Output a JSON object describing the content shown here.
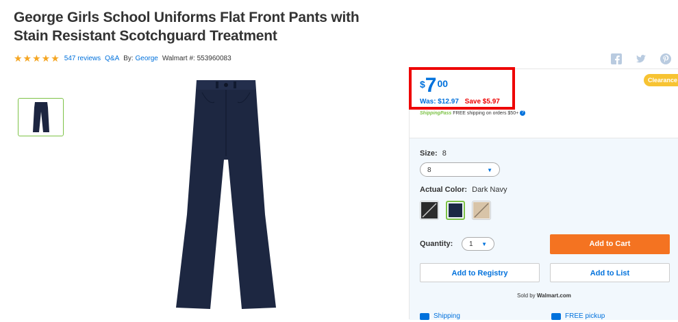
{
  "product": {
    "title": "George Girls School Uniforms Flat Front Pants with Stain Resistant Scotchguard Treatment",
    "rating_stars": "★★★★★",
    "reviews": "547 reviews",
    "qa": "Q&A",
    "by_label": "By:",
    "brand": "George",
    "walmart_number": "Walmart #: 553960083"
  },
  "price": {
    "currency": "$",
    "dollars": "7",
    "cents": "00",
    "was": "Was: $12.97",
    "save": "Save $5.97",
    "badge": "Clearance",
    "shipping_pass": "ShippingPass",
    "shipping_text": "FREE shipping on orders $50+",
    "help_icon": "?"
  },
  "options": {
    "size_label": "Size:",
    "size_value": "8",
    "size_selected": "8",
    "color_label": "Actual Color:",
    "color_value": "Dark Navy",
    "swatches": [
      {
        "name": "black",
        "color": "#2b2b2b"
      },
      {
        "name": "dark-navy",
        "color": "#1b2a44"
      },
      {
        "name": "khaki",
        "color": "#d8c4a8"
      }
    ],
    "quantity_label": "Quantity:",
    "quantity_value": "1"
  },
  "actions": {
    "add_to_cart": "Add to Cart",
    "add_to_registry": "Add to Registry",
    "add_to_list": "Add to List",
    "sold_by_prefix": "Sold by",
    "sold_by": "Walmart.com",
    "shipping": "Shipping",
    "free_pickup": "FREE pickup"
  },
  "colors": {
    "brand_blue": "#0071dc",
    "cart_orange": "#f47321",
    "highlight_red": "#e00000",
    "clearance_yellow": "#f7c332",
    "selected_green": "#7cc245"
  }
}
